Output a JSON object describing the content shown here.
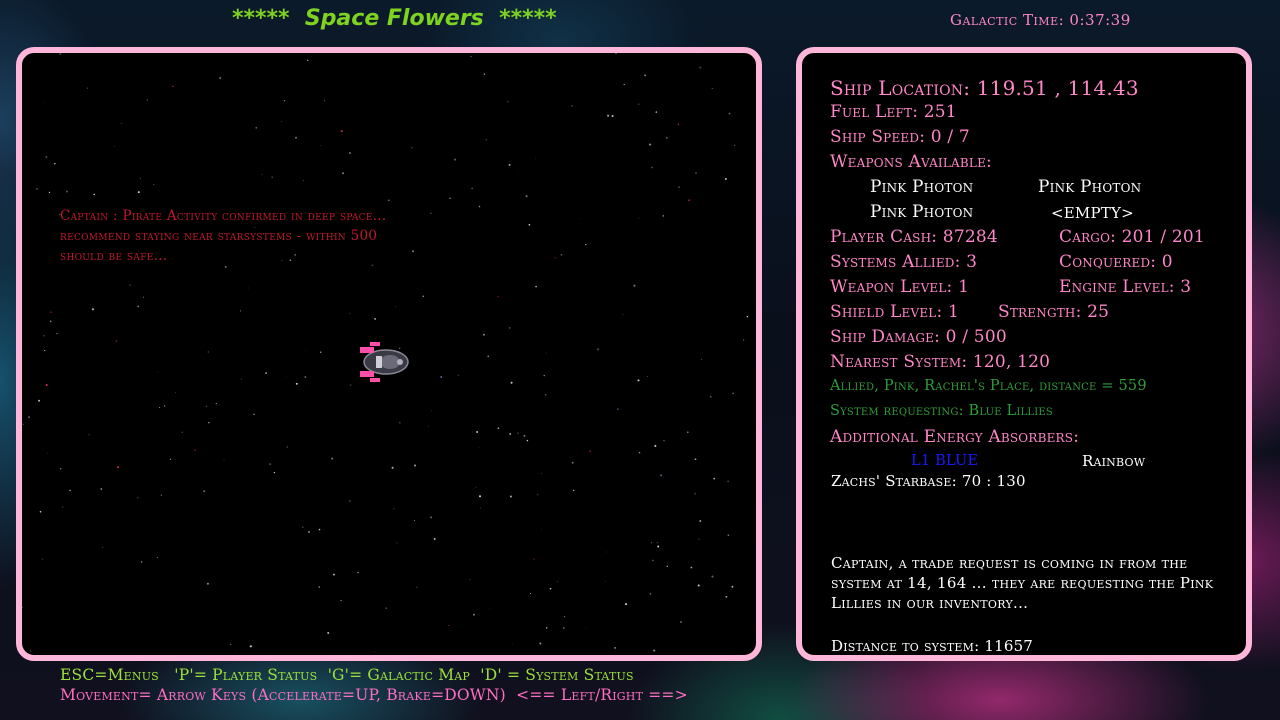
{
  "header": {
    "title": "*****  Space Flowers  *****",
    "galactic_time": "Galactic Time: 0:37:39"
  },
  "space_view": {
    "captain_message": "Captain : Pirate Activity confirmed in deep space... recommend staying near starsystems - within 500 should be safe..."
  },
  "status": {
    "ship_location": "Ship Location: 119.51 ,  114.43",
    "fuel_left": "Fuel Left: 251",
    "ship_speed": "Ship Speed: 0  /  7",
    "weapons_available": "Weapons Available:",
    "weapons": [
      "Pink Photon",
      "Pink Photon",
      "Pink Photon",
      "<EMPTY>"
    ],
    "player_cash": "Player Cash: 87284",
    "cargo": "Cargo:  201 / 201",
    "systems_allied": "Systems Allied: 3",
    "conquered": "Conquered: 0",
    "weapon_level": "Weapon Level: 1",
    "engine_level": "Engine Level: 3",
    "shield_level": "Shield Level: 1",
    "strength": "Strength: 25",
    "ship_damage": "Ship Damage: 0  /  500",
    "nearest_system": "Nearest System: 120, 120",
    "nearest_info": "Allied, Pink, Rachel's Place, distance = 559",
    "system_requesting": "System requesting: Blue Lillies",
    "additional_absorbers": "Additional Energy Absorbers:",
    "absorber_1": "L1 BLUE",
    "absorber_2": "Rainbow",
    "starbase": "Zachs' Starbase: 70 : 130",
    "trade_message": "Captain, a trade request is coming in from the system at 14, 164 ... they are requesting the Pink Lillies in our inventory...",
    "distance_to_system": "Distance to system: 11657"
  },
  "help": {
    "line1": "ESC=Menus   'P'= Player Status  'G'= Galactic Map  'D' = System Status",
    "line2": "Movement= Arrow Keys (Accelerate=UP, Brake=DOWN)  <== Left/Right ==>"
  },
  "colors": {
    "panel_border": "#ffb6d9",
    "stat_pink": "#ff86c8",
    "title_green": "#7ed321",
    "captain_red": "#c0182c",
    "info_green": "#2e9e3a",
    "absorber_blue": "#1a1aff"
  }
}
